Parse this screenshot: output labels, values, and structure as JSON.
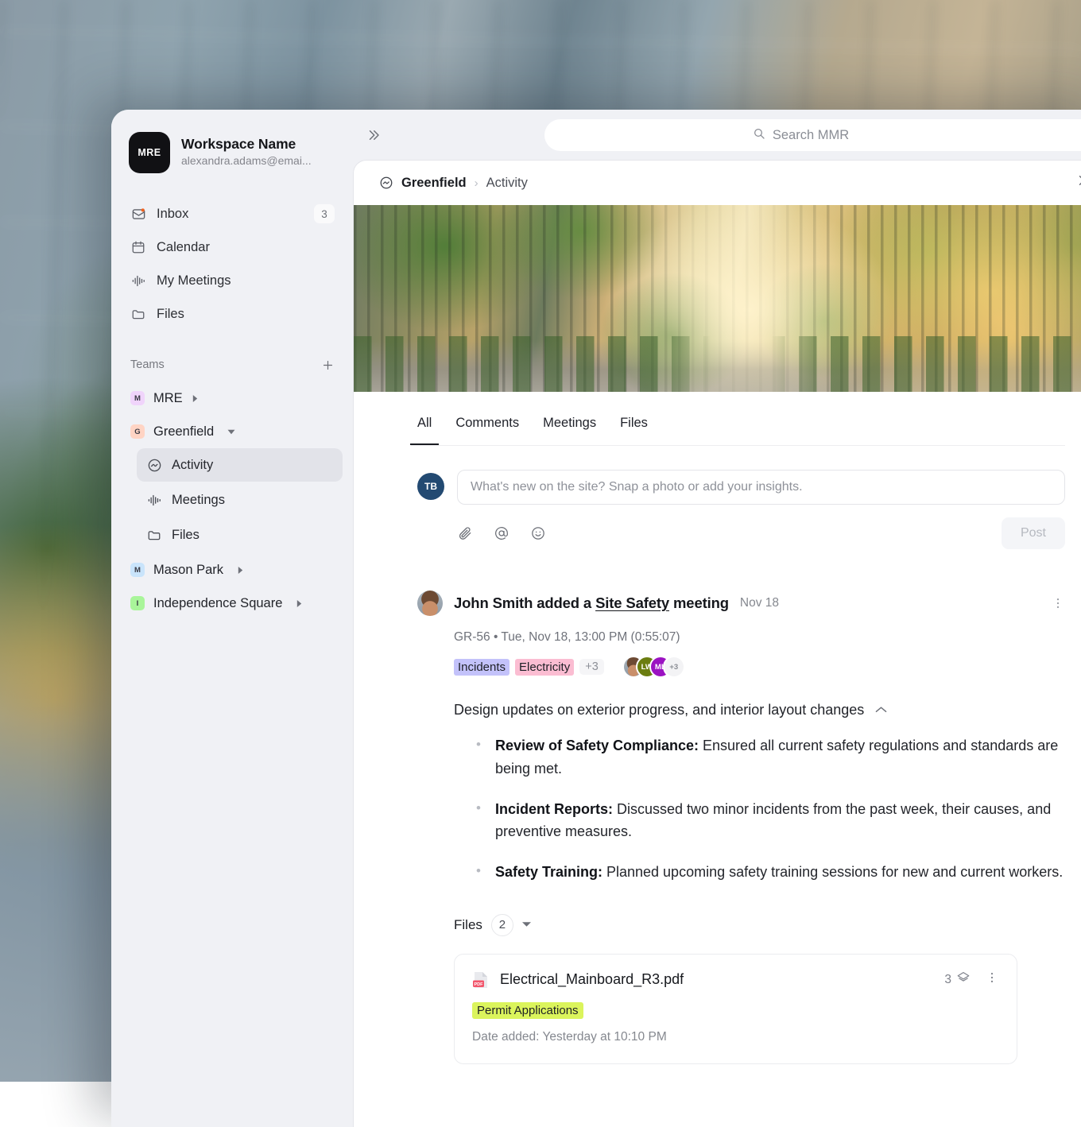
{
  "workspace": {
    "logo_text": "MRE",
    "name": "Workspace Name",
    "email": "alexandra.adams@emai..."
  },
  "sidebar": {
    "nav": [
      {
        "label": "Inbox",
        "icon": "inbox-icon",
        "badge": "3"
      },
      {
        "label": "Calendar",
        "icon": "calendar-icon",
        "badge": ""
      },
      {
        "label": "My Meetings",
        "icon": "waveform-icon",
        "badge": ""
      },
      {
        "label": "Files",
        "icon": "folder-icon",
        "badge": ""
      }
    ],
    "teams_title": "Teams",
    "teams": [
      {
        "label": "MRE",
        "initial": "M",
        "color": "#f0d4fb",
        "expanded": false
      },
      {
        "label": "Greenfield",
        "initial": "G",
        "color": "#ffd4c4",
        "expanded": true
      },
      {
        "label": "Mason Park",
        "initial": "M",
        "color": "#c9e4fb",
        "expanded": false
      },
      {
        "label": "Independence Square",
        "initial": "I",
        "color": "#a9f59a",
        "expanded": false
      }
    ],
    "greenfield_children": [
      {
        "label": "Activity",
        "icon": "activity-icon",
        "active": true
      },
      {
        "label": "Meetings",
        "icon": "waveform-icon",
        "active": false
      },
      {
        "label": "Files",
        "icon": "folder-icon",
        "active": false
      }
    ]
  },
  "topbar": {
    "collapse_icon": "chevrons-right-icon",
    "search_placeholder": "Search MMR"
  },
  "breadcrumb": {
    "icon": "activity-icon",
    "root": "Greenfield",
    "separator": "›",
    "current": "Activity",
    "expand_icon": "chevrons-right-icon"
  },
  "tabs": [
    {
      "label": "All",
      "active": true
    },
    {
      "label": "Comments",
      "active": false
    },
    {
      "label": "Meetings",
      "active": false
    },
    {
      "label": "Files",
      "active": false
    }
  ],
  "composer": {
    "avatar_initials": "TB",
    "placeholder": "What's new on the site? Snap a photo or add your insights.",
    "actions": [
      {
        "icon": "paperclip-icon"
      },
      {
        "icon": "mention-icon"
      },
      {
        "icon": "emoji-icon"
      }
    ],
    "post_label": "Post"
  },
  "post": {
    "author": "John Smith",
    "action_prefix": "John Smith added a ",
    "link_text": "Site Safety",
    "action_suffix": " meeting",
    "date": "Nov 18",
    "meta": "GR-56  •  Tue, Nov 18, 13:00 PM (0:55:07)",
    "tags": [
      {
        "label": "Incidents",
        "color": "#c3c2fa"
      },
      {
        "label": "Electricity",
        "color": "#fbbdd2"
      }
    ],
    "tags_overflow": "+3",
    "attendees": [
      {
        "type": "photo",
        "initials": "",
        "color": ""
      },
      {
        "type": "initials",
        "initials": "LW",
        "color": "#6b7d10"
      },
      {
        "type": "initials",
        "initials": "ML",
        "color": "#9b12c2"
      }
    ],
    "attendees_overflow": "+3",
    "summary_title": "Design updates on exterior progress, and interior layout changes",
    "collapse_icon": "chevron-up-icon",
    "bullets": [
      {
        "label": "Review of Safety Compliance:",
        "text": " Ensured all current safety regulations and standards are being met."
      },
      {
        "label": "Incident Reports:",
        "text": " Discussed two minor incidents from the past week, their causes, and preventive measures."
      },
      {
        "label": "Safety Training:",
        "text": " Planned upcoming safety training sessions for new and current workers."
      }
    ],
    "menu_icon": "kebab-menu-icon"
  },
  "files_section": {
    "label": "Files",
    "count": "2",
    "chevron_icon": "chevron-down-icon",
    "items": [
      {
        "name": "Electrical_Mainboard_R3.pdf",
        "type_icon": "pdf-file-icon",
        "version_count": "3",
        "version_icon": "layers-icon",
        "menu_icon": "kebab-menu-icon",
        "tag": "Permit Applications",
        "tag_color": "#dbf45c",
        "date": "Date added: Yesterday at 10:10 PM"
      }
    ]
  }
}
